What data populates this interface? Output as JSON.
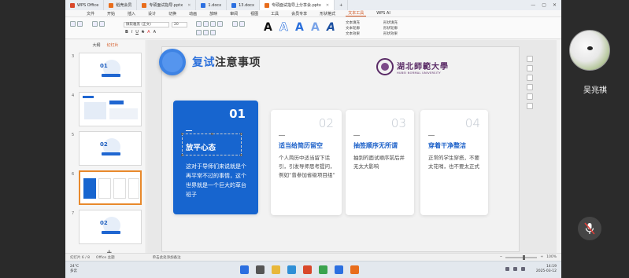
{
  "titlebar": {
    "tabs": [
      {
        "label": "WPS Office",
        "active": false
      },
      {
        "label": "稻壳会员",
        "active": false
      },
      {
        "label": "专硕面试指导.pptx",
        "active": false
      },
      {
        "label": "1.docx",
        "active": false
      },
      {
        "label": "13.docx",
        "active": false
      },
      {
        "label": "专硕面试指导上分享会.pptx",
        "active": true
      }
    ]
  },
  "menubar": {
    "items": [
      "文件",
      "开始",
      "插入",
      "设计",
      "切换",
      "动画",
      "放映",
      "审阅",
      "视图",
      "工具",
      "会员专享",
      "形状格式",
      "文本工具",
      "WPS AI"
    ],
    "active": "文本工具"
  },
  "ribbon": {
    "font_name": "微软雅黑 (正文)",
    "font_size": "20",
    "text_fill": "文本填充",
    "text_outline": "文本轮廓",
    "text_effect": "文本效果",
    "shape_fill": "形状填充",
    "shape_outline": "形状轮廓",
    "shape_effect": "形状效果"
  },
  "leftpanel": {
    "tab_outline": "大纲",
    "tab_slides": "幻灯片",
    "thumbs": [
      {
        "num": "3",
        "label": "01"
      },
      {
        "num": "4",
        "label": ""
      },
      {
        "num": "5",
        "label": "02"
      },
      {
        "num": "6",
        "label": ""
      },
      {
        "num": "7",
        "label": "02"
      }
    ],
    "add_label": "+"
  },
  "slide": {
    "title_prefix": "复试",
    "title_rest": "注意事项",
    "logo_cn": "湖北師範大學",
    "logo_en": "HUBEI NORMAL UNIVERSITY",
    "cards": [
      {
        "num": "01",
        "title": "放平心态",
        "body": "这对于导师们来说就是个再平常不过的事情，这个世界就是一个巨大的草台班子"
      },
      {
        "num": "02",
        "title": "适当给简历留空",
        "body": "个人简历中适当留下话引，引发导师思考提问，例如“曾参加省级项目组”"
      },
      {
        "num": "03",
        "title": "抽签顺序无所谓",
        "body": "抽到的面试顺序前后并无太大影响"
      },
      {
        "num": "04",
        "title": "穿着干净整洁",
        "body": "正常的学生穿搭，不要太花哨，也不要太正式"
      }
    ]
  },
  "statusbar": {
    "slide_info": "幻灯片 6 / 8",
    "theme": "Office 主题",
    "notes_hint": "单击此处添加备注",
    "zoom": "100%"
  },
  "taskbar": {
    "weather_temp": "24°C",
    "weather_text": "多云",
    "time": "14:19",
    "date": "2025-03-12"
  },
  "participant": {
    "name": "吴兆祺"
  },
  "colors": {
    "accent_blue": "#1765cf",
    "wps_orange": "#d2531c"
  }
}
